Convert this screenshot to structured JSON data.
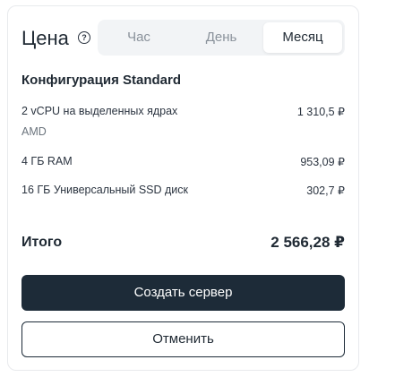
{
  "header": {
    "title": "Цена",
    "help_icon_glyph": "?"
  },
  "period_tabs": {
    "items": [
      {
        "label": "Час"
      },
      {
        "label": "День"
      },
      {
        "label": "Месяц"
      }
    ],
    "selected": "Месяц"
  },
  "config": {
    "title": "Конфигурация Standard",
    "items": [
      {
        "label": "2 vCPU на выделенных ядрах",
        "sublabel": "AMD",
        "price": "1 310,5 ₽"
      },
      {
        "label": "4 ГБ RAM",
        "price": "953,09 ₽"
      },
      {
        "label": "16 ГБ Универсальный SSD диск",
        "price": "302,7 ₽"
      }
    ]
  },
  "total": {
    "label": "Итого",
    "value": "2 566,28 ₽"
  },
  "actions": {
    "create_label": "Создать сервер",
    "cancel_label": "Отменить"
  },
  "colors": {
    "primary": "#1d2b38",
    "muted_text": "#8a929b",
    "segment_bg": "#f2f4f6"
  }
}
